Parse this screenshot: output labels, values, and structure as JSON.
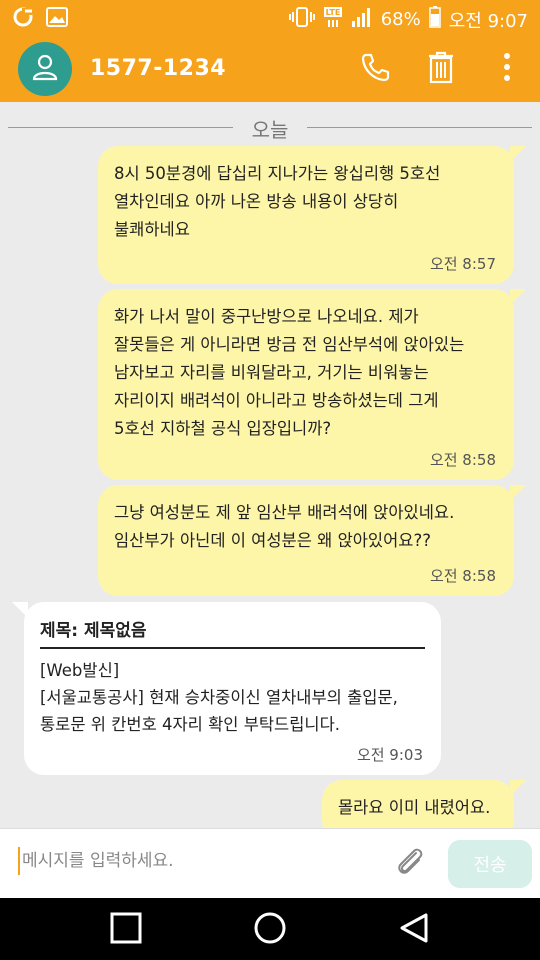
{
  "status_bar": {
    "battery": "68%",
    "time": "오전 9:07",
    "network": "LTE"
  },
  "header": {
    "contact": "1577-1234",
    "icons": [
      "person-icon",
      "phone-icon",
      "trash-icon",
      "more-icon"
    ]
  },
  "date_separator": "오늘",
  "messages": [
    {
      "direction": "out",
      "text": "8시 50분경에 답십리 지나가는 왕십리행 5호선\n열차인데요 아까 나온 방송 내용이 상당히\n불쾌하네요",
      "time": "오전 8:57"
    },
    {
      "direction": "out",
      "text": "화가 나서 말이 중구난방으로 나오네요. 제가\n잘못들은 게 아니라면 방금 전 임산부석에 앉아있는\n남자보고 자리를 비워달라고, 거기는 비워놓는\n자리이지 배려석이 아니라고 방송하셨는데 그게\n5호선 지하철 공식 입장입니까?",
      "time": "오전 8:58"
    },
    {
      "direction": "out",
      "text": "그냥 여성분도 제 앞 임산부 배려석에 앉아있네요.\n임산부가 아닌데 이 여성분은 왜 앉아있어요??",
      "time": "오전 8:58"
    },
    {
      "direction": "in",
      "subject": "제목: 제목없음",
      "text": "[Web발신]\n[서울교통공사] 현재 승차중이신 열차내부의 출입문,\n통로문 위 칸번호 4자리 확인 부탁드립니다.",
      "time": "오전 9:03"
    },
    {
      "direction": "out",
      "text": "몰라요 이미 내렸어요.",
      "time": ""
    }
  ],
  "input": {
    "placeholder": "메시지를 입력하세요.",
    "value": "",
    "send_label": "전송"
  },
  "colors": {
    "accent": "#f7a21b",
    "avatar": "#2e9d8f",
    "outgoing_bubble": "#fdf6a8",
    "incoming_bubble": "#ffffff",
    "background": "#ecebeb"
  }
}
